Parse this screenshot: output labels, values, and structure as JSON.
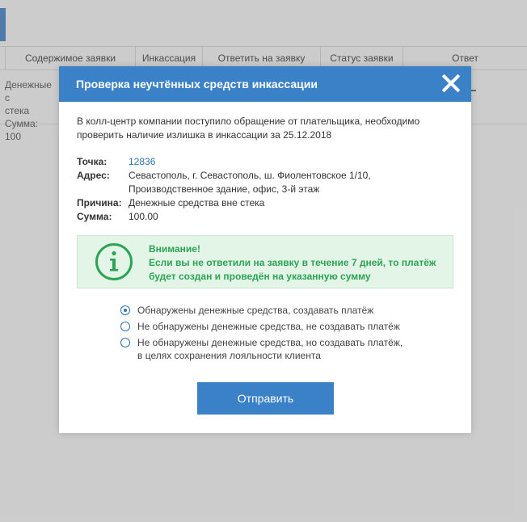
{
  "background": {
    "table_headers": [
      "",
      "Содержимое заявки",
      "Инкассация",
      "Ответить на заявку",
      "Статус заявки",
      "Ответ"
    ],
    "row_text_lines": [
      "Денежные с",
      "стека",
      "Сумма: 100"
    ]
  },
  "modal": {
    "title": "Проверка неучтённых средств инкассации",
    "intro_line1": "В колл-центр компании поступило обращение от плательщика, необходимо",
    "intro_line2": "проверить наличие излишка в инкассации за 25.12.2018",
    "details": {
      "point_label": "Точка:",
      "point_value": "12836",
      "address_label": "Адрес:",
      "address_line1": "Севастополь, г. Севастополь, ш. Фиолентовское 1/10,",
      "address_line2": "Производственное здание, офис, 3-й этаж",
      "reason_label": "Причина:",
      "reason_value": "Денежные средства вне стека",
      "sum_label": "Сумма:",
      "sum_value": "100.00"
    },
    "notice": {
      "icon": "info-icon",
      "title": "Внимание!",
      "line1": "Если вы не ответили на заявку в течение 7 дней, то платёж",
      "line2": "будет создан и проведён на указанную сумму"
    },
    "options": [
      {
        "lines": [
          "Обнаружены денежные средства, создавать платёж"
        ],
        "checked": true
      },
      {
        "lines": [
          "Не обнаружены денежные средства, не создавать платёж"
        ],
        "checked": false
      },
      {
        "lines": [
          "Не обнаружены денежные средства, но создавать платёж,",
          "в целях сохранения лояльности клиента"
        ],
        "checked": false
      }
    ],
    "submit_label": "Отправить"
  },
  "colors": {
    "primary": "#3a81c8",
    "notice_bg": "#e2f5e7",
    "notice_text": "#2ea356",
    "link": "#2e73b8"
  }
}
